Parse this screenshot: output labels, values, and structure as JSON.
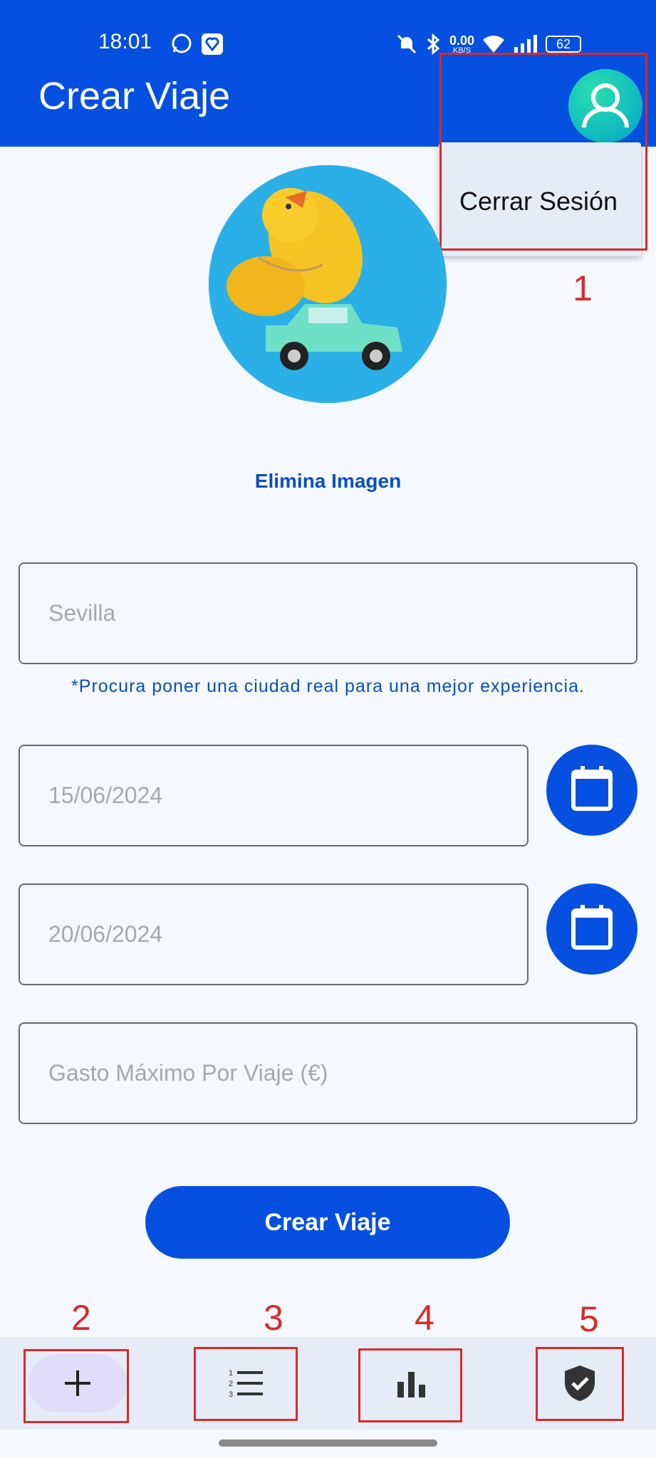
{
  "status_bar": {
    "time": "18:01",
    "net_speed": "0.00",
    "net_unit": "KB/S",
    "battery": "62"
  },
  "app_bar": {
    "title": "Crear Viaje"
  },
  "profile_menu": {
    "items": [
      "Cerrar Sesión"
    ]
  },
  "image": {
    "remove_label": "Elimina Imagen"
  },
  "form": {
    "city": {
      "placeholder": "Sevilla",
      "value": ""
    },
    "city_hint": "*Procura poner una ciudad real para una mejor experiencia.",
    "start_date": {
      "placeholder": "15/06/2024",
      "value": ""
    },
    "end_date": {
      "placeholder": "20/06/2024",
      "value": ""
    },
    "budget": {
      "placeholder": "Gasto Máximo Por Viaje (€)",
      "value": ""
    },
    "submit_label": "Crear Viaje"
  },
  "bottom_nav": {
    "items": [
      {
        "icon": "plus-icon",
        "active": true
      },
      {
        "icon": "numbered-list-icon",
        "active": false
      },
      {
        "icon": "bar-chart-icon",
        "active": false
      },
      {
        "icon": "shield-check-icon",
        "active": false
      }
    ]
  },
  "annotations": [
    "1",
    "2",
    "3",
    "4",
    "5"
  ],
  "colors": {
    "primary": "#0550e0",
    "annotation": "#d92a2a",
    "surface": "#f5f8fd",
    "nav_bg": "#e6ebf8"
  }
}
